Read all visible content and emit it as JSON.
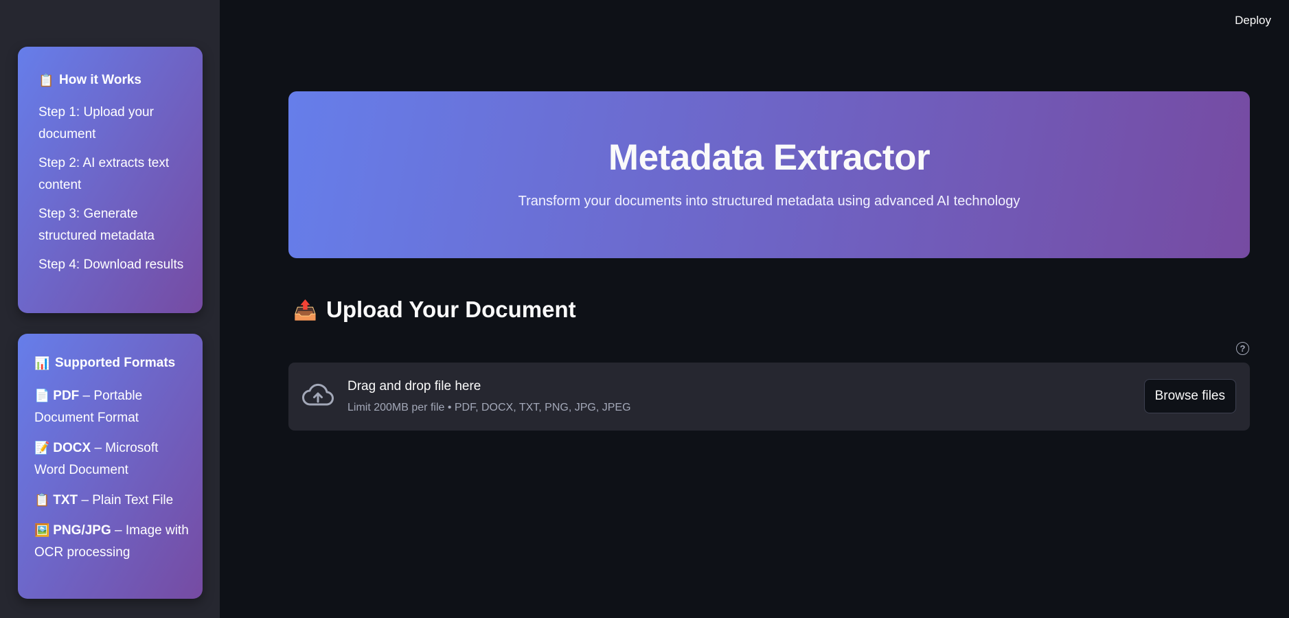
{
  "header": {
    "deploy_label": "Deploy"
  },
  "sidebar": {
    "how_it_works": {
      "icon": "clipboard-icon",
      "title": "How it Works",
      "steps": [
        "Step 1: Upload your document",
        "Step 2: AI extracts text content",
        "Step 3: Generate structured metadata",
        "Step 4: Download results"
      ]
    },
    "supported_formats": {
      "icon": "bar-chart-icon",
      "title": "Supported Formats",
      "items": [
        {
          "icon": "page-icon",
          "name": "PDF",
          "desc": " – Portable Document Format"
        },
        {
          "icon": "memo-icon",
          "name": "DOCX",
          "desc": " – Microsoft Word Document"
        },
        {
          "icon": "clipboard-icon",
          "name": "TXT",
          "desc": " – Plain Text File"
        },
        {
          "icon": "picture-icon",
          "name": "PNG/JPG",
          "desc": " – Image with OCR processing"
        }
      ]
    }
  },
  "hero": {
    "title": "Metadata Extractor",
    "subtitle": "Transform your documents into structured metadata using advanced AI technology"
  },
  "upload": {
    "icon": "outbox-tray-icon",
    "heading": "Upload Your Document",
    "dropzone_title": "Drag and drop file here",
    "dropzone_limit": "Limit 200MB per file • PDF, DOCX, TXT, PNG, JPG, JPEG",
    "browse_label": "Browse files",
    "help_symbol": "?"
  },
  "colors": {
    "background": "#0e1117",
    "sidebar": "#262730",
    "gradient_start": "#667eea",
    "gradient_end": "#764ba2"
  }
}
